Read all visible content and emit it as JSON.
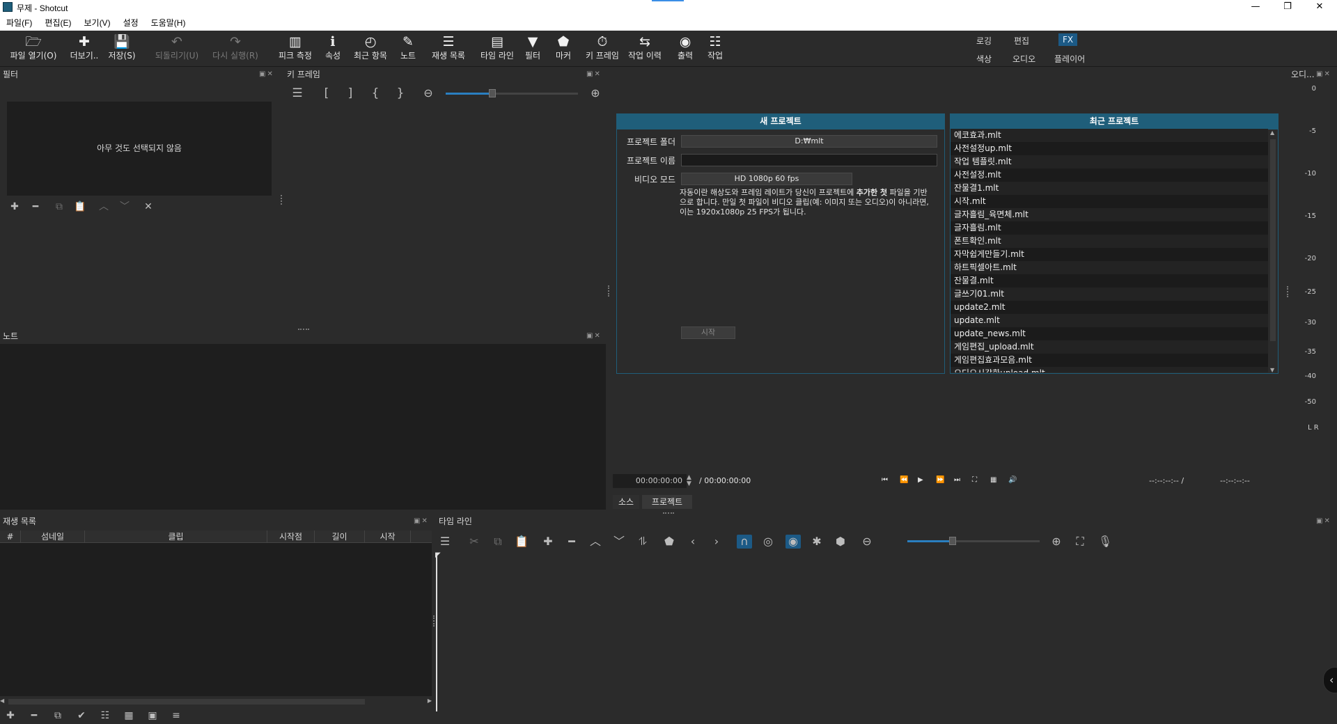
{
  "window": {
    "title": "무제 - Shotcut"
  },
  "menu": [
    "파일(F)",
    "편집(E)",
    "보기(V)",
    "설정",
    "도움말(H)"
  ],
  "toolbar": [
    {
      "label": "파일 열기(O)",
      "icon": "open-folder-icon",
      "glyph": "🗁",
      "enabled": true
    },
    {
      "label": "더보기..",
      "icon": "open-other-icon",
      "glyph": "✚",
      "enabled": true
    },
    {
      "label": "저장(S)",
      "icon": "save-icon",
      "glyph": "💾",
      "enabled": true
    },
    {
      "label": "되돌리기(U)",
      "icon": "undo-icon",
      "glyph": "↶",
      "enabled": false
    },
    {
      "label": "다시 실행(R)",
      "icon": "redo-icon",
      "glyph": "↷",
      "enabled": false
    },
    {
      "label": "피크 측정",
      "icon": "peak-meter-icon",
      "glyph": "▥",
      "enabled": true
    },
    {
      "label": "속성",
      "icon": "properties-icon",
      "glyph": "ℹ",
      "enabled": true
    },
    {
      "label": "최근 항목",
      "icon": "recent-icon",
      "glyph": "◴",
      "enabled": true
    },
    {
      "label": "노트",
      "icon": "notes-icon",
      "glyph": "✎",
      "enabled": true
    },
    {
      "label": "재생 목록",
      "icon": "playlist-icon",
      "glyph": "☰",
      "enabled": true
    },
    {
      "label": "타임 라인",
      "icon": "timeline-icon",
      "glyph": "▤",
      "enabled": true
    },
    {
      "label": "필터",
      "icon": "filter-icon",
      "glyph": "▼",
      "enabled": true
    },
    {
      "label": "마커",
      "icon": "marker-icon",
      "glyph": "⬟",
      "enabled": true
    },
    {
      "label": "키 프레임",
      "icon": "keyframes-icon",
      "glyph": "⏱",
      "enabled": true
    },
    {
      "label": "작업 이력",
      "icon": "history-icon",
      "glyph": "⇆",
      "enabled": true
    },
    {
      "label": "출력",
      "icon": "export-icon",
      "glyph": "◉",
      "enabled": true
    },
    {
      "label": "작업",
      "icon": "jobs-icon",
      "glyph": "☷",
      "enabled": true
    }
  ],
  "layouts": [
    {
      "label": "로깅",
      "active": false
    },
    {
      "label": "편집",
      "active": false
    },
    {
      "label": "FX",
      "active": true
    },
    {
      "label": "색상",
      "active": false
    },
    {
      "label": "오디오",
      "active": false
    },
    {
      "label": "플레이어",
      "active": false
    }
  ],
  "filters_panel": {
    "title": "필터",
    "empty_text": "아무 것도 선택되지 않음"
  },
  "keyframes_panel": {
    "title": "키 프레임"
  },
  "notes_panel": {
    "title": "노트"
  },
  "start_page": {
    "new_project": {
      "header": "새 프로젝트",
      "folder_label": "프로젝트 폴더",
      "folder_value": "D:₩mlt",
      "name_label": "프로젝트 이름",
      "name_value": "",
      "video_mode_label": "비디오 모드",
      "video_mode_value": "HD 1080p 60 fps",
      "description_prefix": "자동이란 해상도와 프레임 레이트가 당신이 프로젝트에 ",
      "description_bold": "추가한 첫",
      "description_suffix": " 파일을 기반으로 합니다. 만일 첫 파일이 비디오 클립(예: 이미지 또는 오디오)이 아니라면, 이는 1920x1080p 25 FPS가 됩니다.",
      "start_button": "시작"
    },
    "recent_projects": {
      "header": "최근 프로젝트",
      "items": [
        "에코효과.mlt",
        "사전설정up.mlt",
        "작업 템플릿.mlt",
        "사전설정.mlt",
        "잔물결1.mlt",
        "시작.mlt",
        "글자흘림_육면체.mlt",
        "글자흘림.mlt",
        "폰트확인.mlt",
        "자막쉽게만들기.mlt",
        "하트픽셀아트.mlt",
        "잔물결.mlt",
        "글쓰기01.mlt",
        "update2.mlt",
        "update.mlt",
        "update_news.mlt",
        "게임편집_upload.mlt",
        "게임편집효과모음.mlt",
        "오디오시각화upload.mlt"
      ]
    }
  },
  "player": {
    "position": "00:00:00:00",
    "duration": "/ 00:00:00:00",
    "in_point": "--:--:--:-- /",
    "out_point": "--:--:--:--",
    "tabs": [
      "소스",
      "프로젝트"
    ]
  },
  "audio_meter": {
    "title": "오디...",
    "ticks": [
      "0",
      "-5",
      "-10",
      "-15",
      "-20",
      "-25",
      "-30",
      "-35",
      "-40",
      "-50"
    ],
    "channels": "L  R"
  },
  "playlist": {
    "title": "재생 목록",
    "columns": [
      "#",
      "섬네일",
      "클립",
      "시작점",
      "길이",
      "시작"
    ]
  },
  "timeline": {
    "title": "타임 라인"
  }
}
